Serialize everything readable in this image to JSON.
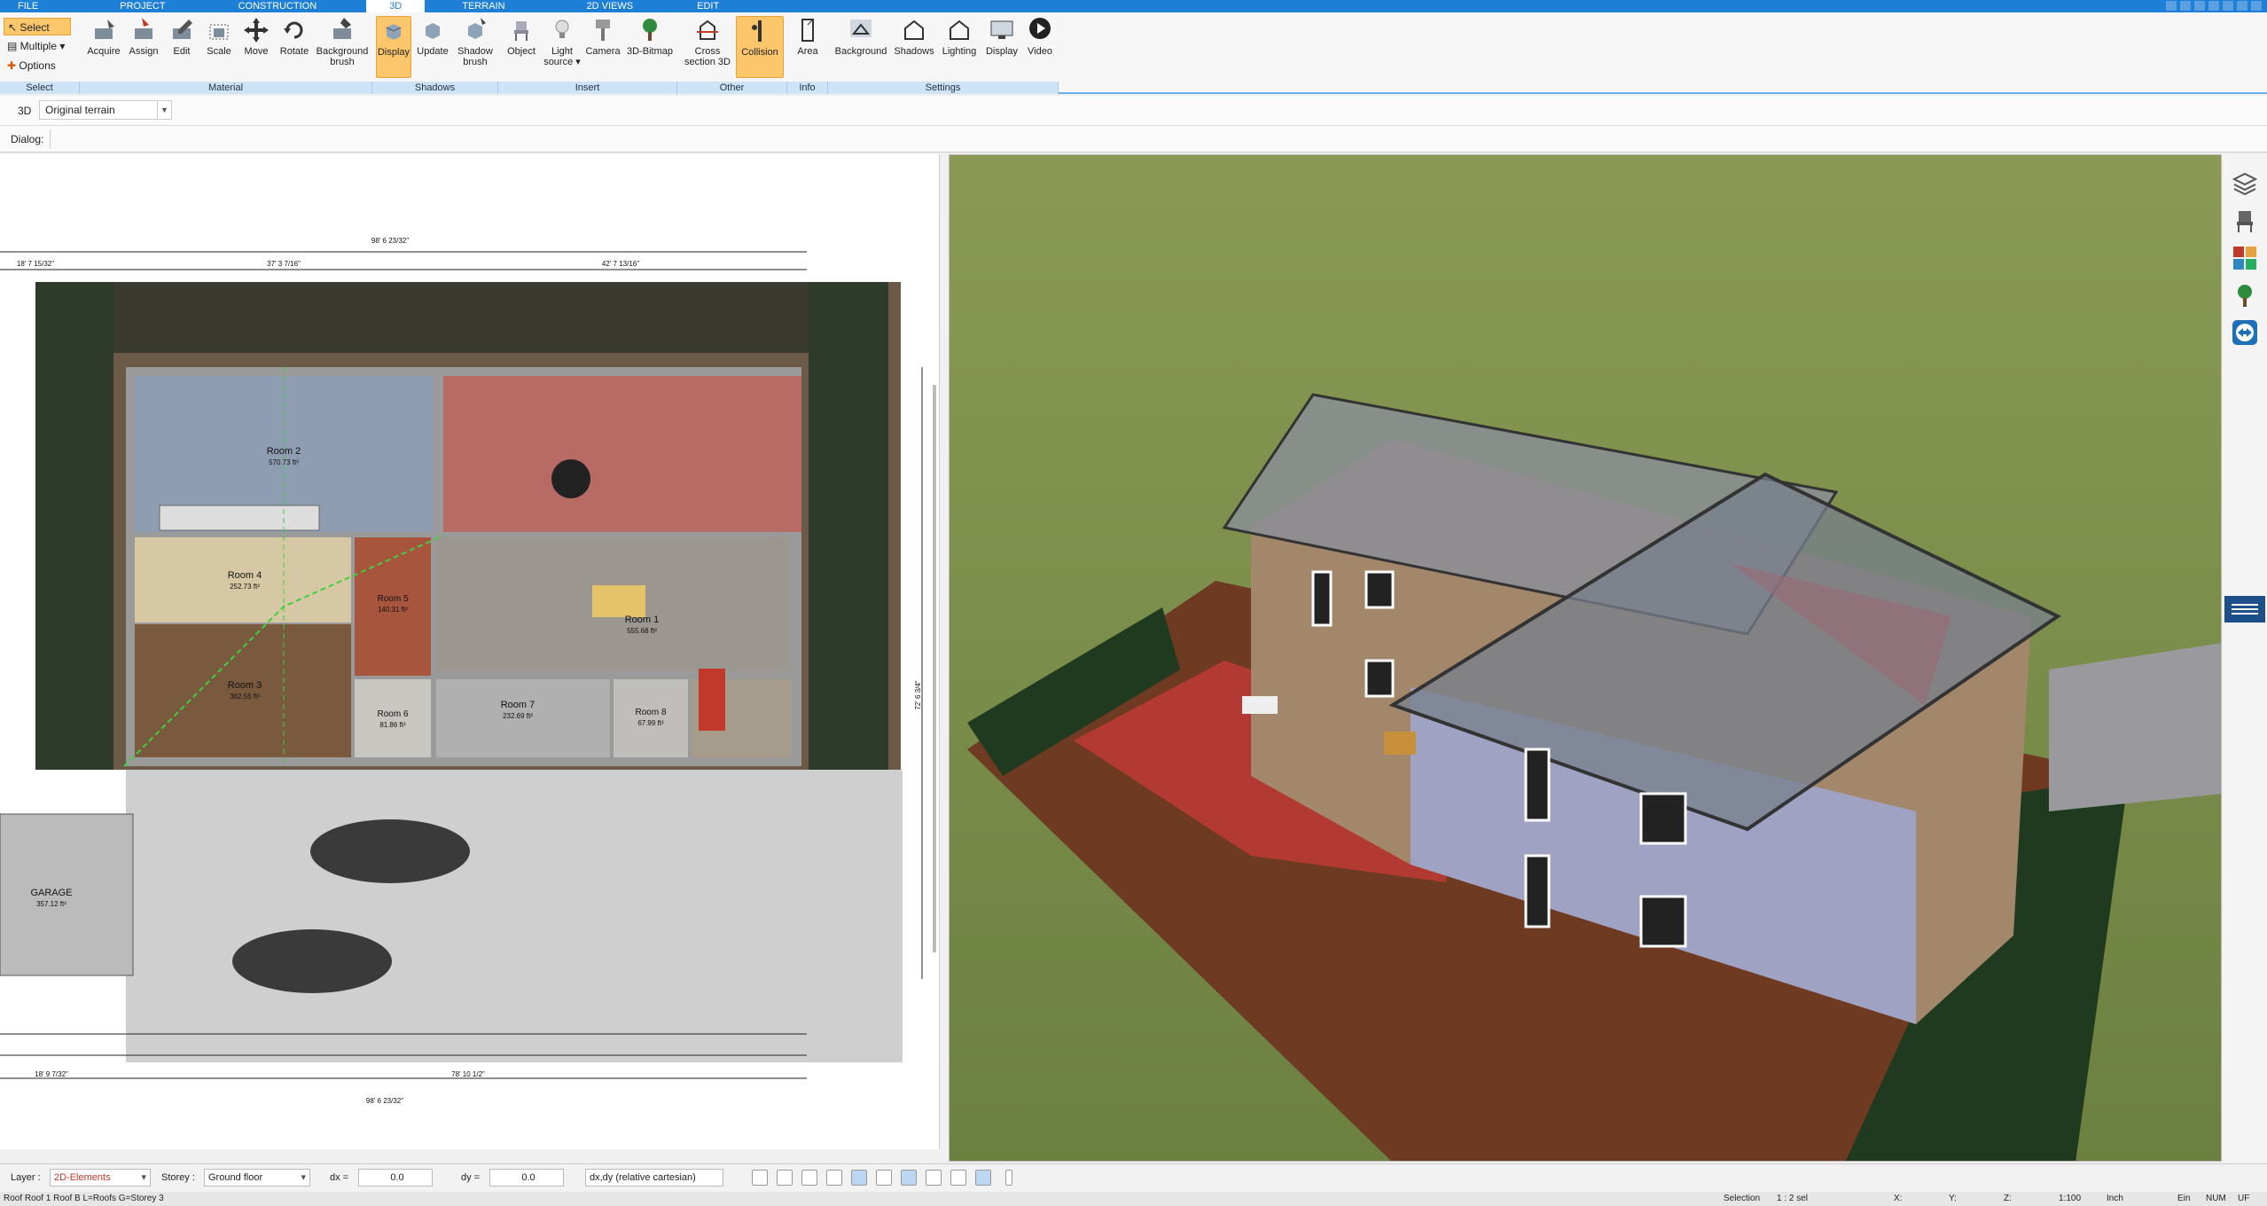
{
  "menu": {
    "tabs": [
      "FILE",
      "PROJECT",
      "CONSTRUCTION",
      "3D",
      "TERRAIN",
      "2D VIEWS",
      "EDIT"
    ],
    "active_tab": "3D"
  },
  "ribbon": {
    "select_group": {
      "select": "Select",
      "multiple": "Multiple",
      "options": "Options",
      "label": "Select"
    },
    "material_group": {
      "acquire": "Acquire",
      "assign": "Assign",
      "edit": "Edit",
      "scale": "Scale",
      "move": "Move",
      "rotate": "Rotate",
      "background_brush": "Background brush",
      "label": "Material"
    },
    "shadows_group": {
      "display": "Display",
      "update": "Update",
      "shadow_brush": "Shadow brush",
      "label": "Shadows"
    },
    "insert_group": {
      "object": "Object",
      "light_source": "Light source",
      "camera": "Camera",
      "bitmap3d": "3D-Bitmap",
      "label": "Insert"
    },
    "other_group": {
      "cross_section": "Cross section 3D",
      "collision": "Collision",
      "label": "Other"
    },
    "info_group": {
      "area": "Area",
      "label": "Info"
    },
    "settings_group": {
      "background": "Background",
      "shadows": "Shadows",
      "lighting": "Lighting",
      "display": "Display",
      "video": "Video",
      "label": "Settings"
    }
  },
  "subbar": {
    "mode": "3D",
    "terrain": "Original terrain",
    "dialog_label": "Dialog:"
  },
  "plan": {
    "rooms": [
      {
        "name": "Room 2",
        "area": "570.73 ft²"
      },
      {
        "name": "Room 4",
        "area": "252.73 ft²"
      },
      {
        "name": "Room 3",
        "area": "362.55 ft²"
      },
      {
        "name": "Room 1",
        "area": "555.68 ft²"
      },
      {
        "name": "Room 5",
        "area": "140.31 ft²"
      },
      {
        "name": "Room 6",
        "area": "81.86 ft²"
      },
      {
        "name": "Room 7",
        "area": "232.69 ft²"
      },
      {
        "name": "Room 8",
        "area": "67.99 ft²"
      },
      {
        "name": "GARAGE",
        "area": "357.12 ft²"
      }
    ],
    "dims": {
      "top_total": "98' 6 23/32\"",
      "top_left": "37' 3 7/16\"",
      "top_right": "42' 7 13/16\"",
      "top_far_left": "18' 7 15/32\"",
      "bottom_total": "98' 6 23/32\"",
      "bottom_mid": "78' 10 1/2\"",
      "bottom_left": "18' 9 7/32\"",
      "right_total": "72' 6 3/4\""
    }
  },
  "bottombar": {
    "layer_label": "Layer :",
    "layer_value": "2D-Elements",
    "storey_label": "Storey :",
    "storey_value": "Ground floor",
    "dx_label": "dx =",
    "dx_value": "0.0",
    "dy_label": "dy =",
    "dy_value": "0.0",
    "coord_mode": "dx,dy (relative cartesian)"
  },
  "statusbar": {
    "left": "Roof Roof 1 Roof B L=Roofs G=Storey 3",
    "selection": "Selection",
    "sel_count": "1 : 2 sel",
    "x": "X:",
    "y": "Y:",
    "z": "Z:",
    "scale": "1:100",
    "unit": "Inch",
    "ein": "Ein",
    "num": "NUM",
    "uf": "UF"
  },
  "colors": {
    "accent": "#1e7fd6",
    "active_button": "#fcc76b",
    "layer_text": "#c0392b"
  }
}
